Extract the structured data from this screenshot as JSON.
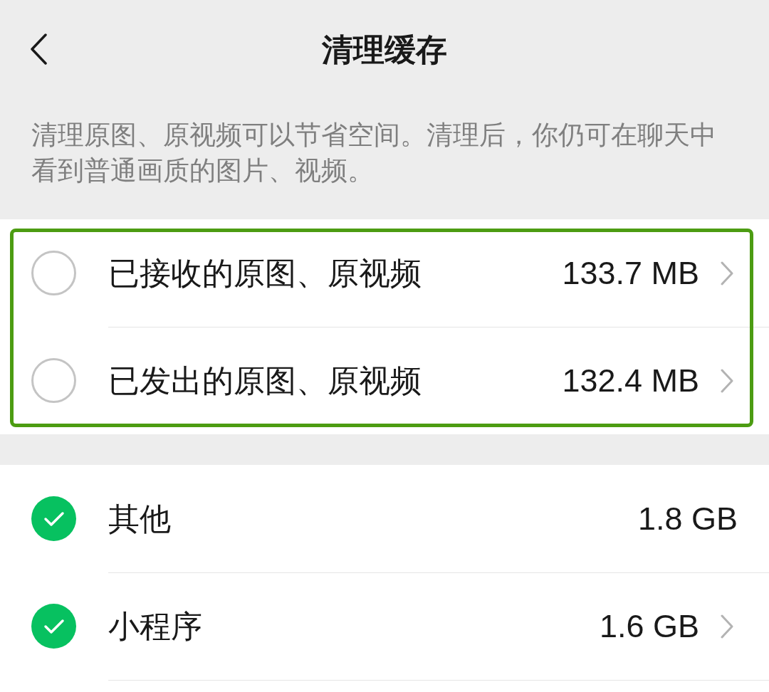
{
  "header": {
    "title": "清理缓存"
  },
  "description": "清理原图、原视频可以节省空间。清理后，你仍可在聊天中看到普通画质的图片、视频。",
  "groups": [
    {
      "highlighted": true,
      "items": [
        {
          "label": "已接收的原图、原视频",
          "size": "133.7 MB",
          "checked": false,
          "has_chevron": true
        },
        {
          "label": "已发出的原图、原视频",
          "size": "132.4 MB",
          "checked": false,
          "has_chevron": true
        }
      ]
    },
    {
      "highlighted": false,
      "items": [
        {
          "label": "其他",
          "size": "1.8 GB",
          "checked": true,
          "has_chevron": false
        },
        {
          "label": "小程序",
          "size": "1.6 GB",
          "checked": true,
          "has_chevron": true
        }
      ]
    }
  ]
}
